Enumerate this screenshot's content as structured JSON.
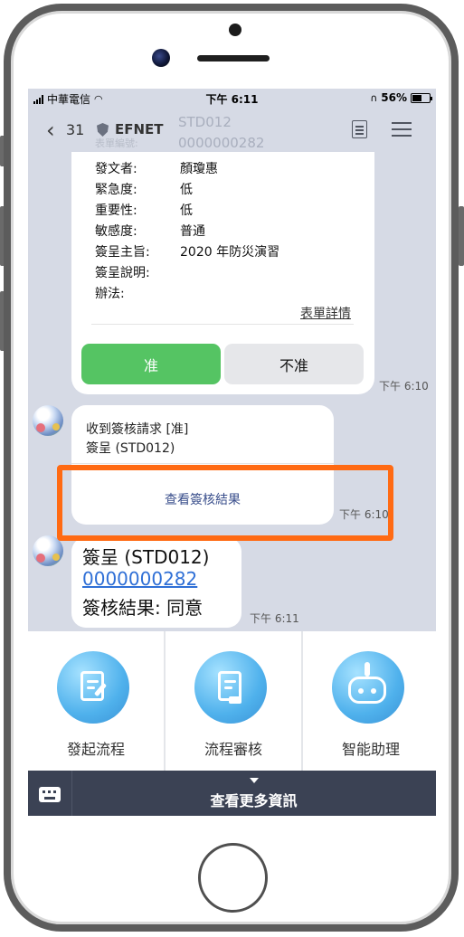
{
  "status_bar": {
    "carrier": "中華電信",
    "time": "下午 6:11",
    "battery": "56%",
    "battery_level": 0.56
  },
  "nav": {
    "back_count": "31",
    "name": "EFNET",
    "ghost_code": "STD012",
    "ghost_label": "表單編號:",
    "ghost_number": "0000000282"
  },
  "form": {
    "fields": [
      {
        "label": "發文者:",
        "value": "顏瓊惠"
      },
      {
        "label": "緊急度:",
        "value": "低"
      },
      {
        "label": "重要性:",
        "value": "低"
      },
      {
        "label": "敏感度:",
        "value": "普通"
      },
      {
        "label": "簽呈主旨:",
        "value": "2020 年防災演習"
      },
      {
        "label": "簽呈說明:",
        "value": ""
      },
      {
        "label": "辦法:",
        "value": ""
      }
    ],
    "detail_link": "表單詳情",
    "approve_label": "准",
    "reject_label": "不准",
    "timestamp": "下午 6:10"
  },
  "request": {
    "line1": "收到簽核請求 [准]",
    "line2": "簽呈 (STD012)",
    "view_result": "查看簽核結果",
    "timestamp": "下午 6:10"
  },
  "result": {
    "line1": "簽呈 (STD012)",
    "number": "0000000282",
    "line3": "簽核結果: 同意",
    "timestamp": "下午 6:11"
  },
  "actions": [
    {
      "label": "發起流程",
      "icon": "edit-document-icon"
    },
    {
      "label": "流程審核",
      "icon": "stamp-document-icon"
    },
    {
      "label": "智能助理",
      "icon": "robot-icon"
    }
  ],
  "more_bar": {
    "label": "查看更多資訊",
    "icon": "keyboard-icon"
  },
  "colors": {
    "approve": "#55c463",
    "highlight": "#ff6a13",
    "link": "#2f6fd6",
    "bottom_bar": "#3b4254"
  }
}
